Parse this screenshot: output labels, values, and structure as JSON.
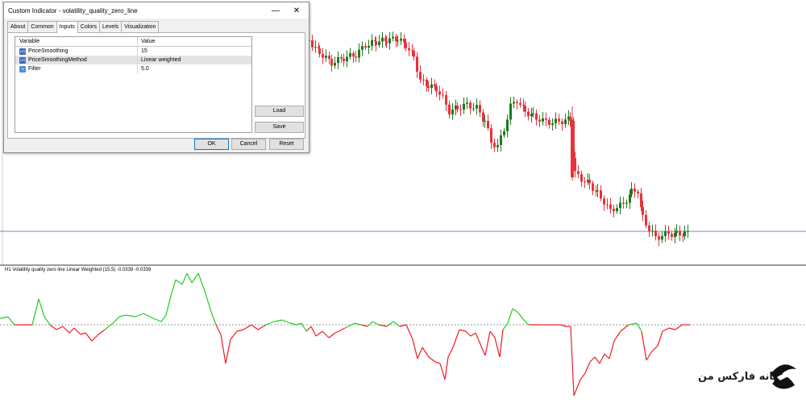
{
  "dialog": {
    "title": "Custom Indicator - volatility_quality_zero_line",
    "tabs": [
      "About",
      "Common",
      "Inputs",
      "Colors",
      "Levels",
      "Visualization"
    ],
    "active_tab": "Inputs",
    "table": {
      "headers": [
        "Variable",
        "Value"
      ],
      "rows": [
        {
          "variable": "PriceSmoothing",
          "value": "15",
          "icon": "int-param-icon",
          "icon_text": "123"
        },
        {
          "variable": "PriceSmoothingMethod",
          "value": "Linear weighted",
          "icon": "enum-param-icon",
          "icon_text": "123"
        },
        {
          "variable": "Filter",
          "value": "5.0",
          "icon": "double-param-icon",
          "icon_text": "½"
        }
      ]
    },
    "buttons": {
      "load": "Load",
      "save": "Save",
      "ok": "OK",
      "cancel": "Cancel",
      "reset": "Reset"
    },
    "minimize_glyph": "—",
    "close_glyph": "✕"
  },
  "indicator": {
    "label": "H1 Volatility quality zero line Linear Weighted (15,5) -0.0339 -0.0339"
  },
  "watermark": {
    "text": "خانه فارکس من"
  },
  "colors": {
    "bull": "#1e7a1e",
    "bear": "#e8323c",
    "indicator_up": "#22cc22",
    "indicator_down": "#ee1c24",
    "price_line": "#8080c0",
    "divider": "#a0a0a0"
  }
}
